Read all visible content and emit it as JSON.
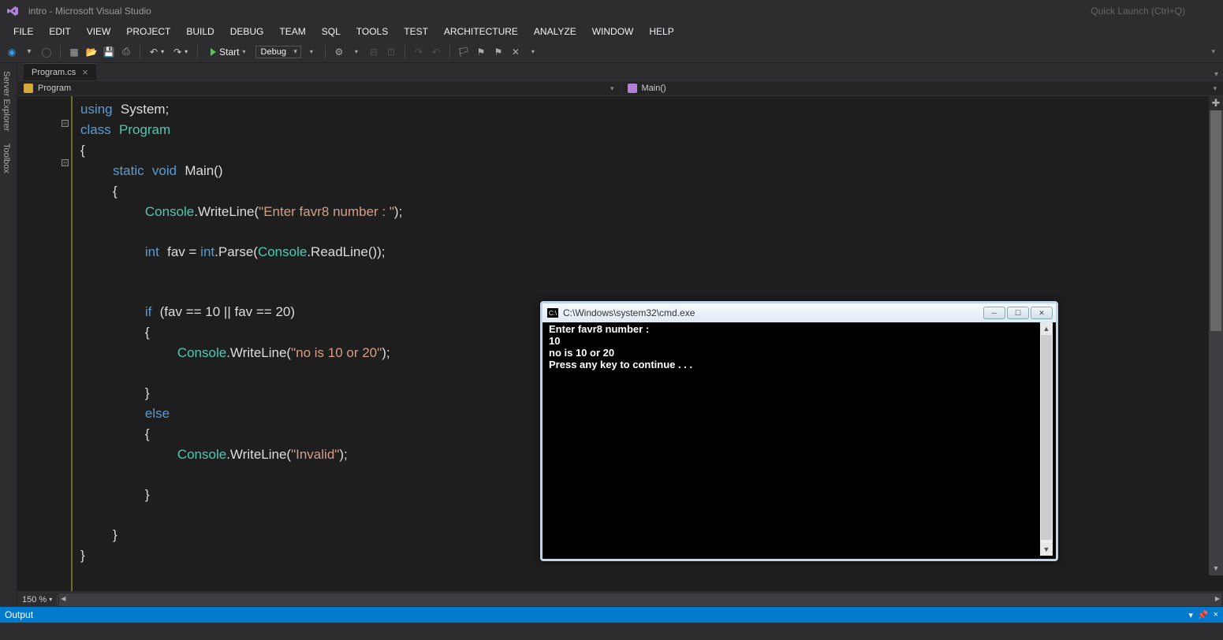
{
  "app": {
    "title": "intro - Microsoft Visual Studio",
    "quick_launch_placeholder": "Quick Launch (Ctrl+Q)"
  },
  "menu": [
    "FILE",
    "EDIT",
    "VIEW",
    "PROJECT",
    "BUILD",
    "DEBUG",
    "TEAM",
    "SQL",
    "TOOLS",
    "TEST",
    "ARCHITECTURE",
    "ANALYZE",
    "WINDOW",
    "HELP"
  ],
  "toolbar": {
    "start_label": "Start",
    "debug_label": "Debug"
  },
  "side_tabs": [
    "Server Explorer",
    "Toolbox"
  ],
  "file_tab": {
    "name": "Program.cs"
  },
  "nav": {
    "left": "Program",
    "right": "Main()"
  },
  "code": {
    "tokens": [
      {
        "t": "kw",
        "v": "using"
      },
      {
        "t": "sp",
        "v": " "
      },
      {
        "t": "ident",
        "v": "System;"
      },
      {
        "t": "nl"
      },
      {
        "t": "kw",
        "v": "class"
      },
      {
        "t": "sp",
        "v": " "
      },
      {
        "t": "type",
        "v": "Program"
      },
      {
        "t": "nl"
      },
      {
        "t": "ident",
        "v": "{"
      },
      {
        "t": "nl"
      },
      {
        "t": "sp",
        "v": "    "
      },
      {
        "t": "kw",
        "v": "static"
      },
      {
        "t": "sp",
        "v": " "
      },
      {
        "t": "kw",
        "v": "void"
      },
      {
        "t": "sp",
        "v": " "
      },
      {
        "t": "ident",
        "v": "Main()"
      },
      {
        "t": "nl"
      },
      {
        "t": "sp",
        "v": "    "
      },
      {
        "t": "ident",
        "v": "{"
      },
      {
        "t": "nl"
      },
      {
        "t": "sp",
        "v": "        "
      },
      {
        "t": "type",
        "v": "Console"
      },
      {
        "t": "ident",
        "v": ".WriteLine("
      },
      {
        "t": "str",
        "v": "\"Enter favr8 number : \""
      },
      {
        "t": "ident",
        "v": ");"
      },
      {
        "t": "nl"
      },
      {
        "t": "nl"
      },
      {
        "t": "sp",
        "v": "        "
      },
      {
        "t": "kw",
        "v": "int"
      },
      {
        "t": "sp",
        "v": " "
      },
      {
        "t": "ident",
        "v": "fav = "
      },
      {
        "t": "kw",
        "v": "int"
      },
      {
        "t": "ident",
        "v": ".Parse("
      },
      {
        "t": "type",
        "v": "Console"
      },
      {
        "t": "ident",
        "v": ".ReadLine());"
      },
      {
        "t": "nl"
      },
      {
        "t": "nl"
      },
      {
        "t": "nl"
      },
      {
        "t": "sp",
        "v": "        "
      },
      {
        "t": "kw",
        "v": "if"
      },
      {
        "t": "sp",
        "v": " "
      },
      {
        "t": "ident",
        "v": "(fav == 10 || fav == 20)"
      },
      {
        "t": "nl"
      },
      {
        "t": "sp",
        "v": "        "
      },
      {
        "t": "ident",
        "v": "{"
      },
      {
        "t": "nl"
      },
      {
        "t": "sp",
        "v": "            "
      },
      {
        "t": "type",
        "v": "Console"
      },
      {
        "t": "ident",
        "v": ".WriteLine("
      },
      {
        "t": "str",
        "v": "\"no is 10 or 20\""
      },
      {
        "t": "ident",
        "v": ");"
      },
      {
        "t": "nl"
      },
      {
        "t": "nl"
      },
      {
        "t": "sp",
        "v": "        "
      },
      {
        "t": "ident",
        "v": "}"
      },
      {
        "t": "nl"
      },
      {
        "t": "sp",
        "v": "        "
      },
      {
        "t": "kw",
        "v": "else"
      },
      {
        "t": "nl"
      },
      {
        "t": "sp",
        "v": "        "
      },
      {
        "t": "ident",
        "v": "{"
      },
      {
        "t": "nl"
      },
      {
        "t": "sp",
        "v": "            "
      },
      {
        "t": "type",
        "v": "Console"
      },
      {
        "t": "ident",
        "v": ".WriteLine("
      },
      {
        "t": "str",
        "v": "\"Invalid\""
      },
      {
        "t": "ident",
        "v": ");"
      },
      {
        "t": "nl"
      },
      {
        "t": "nl"
      },
      {
        "t": "sp",
        "v": "        "
      },
      {
        "t": "ident",
        "v": "}"
      },
      {
        "t": "nl"
      },
      {
        "t": "nl"
      },
      {
        "t": "sp",
        "v": "    "
      },
      {
        "t": "ident",
        "v": "}"
      },
      {
        "t": "nl"
      },
      {
        "t": "ident",
        "v": "}"
      },
      {
        "t": "nl"
      }
    ]
  },
  "zoom": "150 %",
  "output": {
    "label": "Output"
  },
  "cmd": {
    "title": "C:\\Windows\\system32\\cmd.exe",
    "lines": [
      "Enter favr8 number :",
      "10",
      "no is 10 or 20",
      "Press any key to continue . . ."
    ]
  }
}
